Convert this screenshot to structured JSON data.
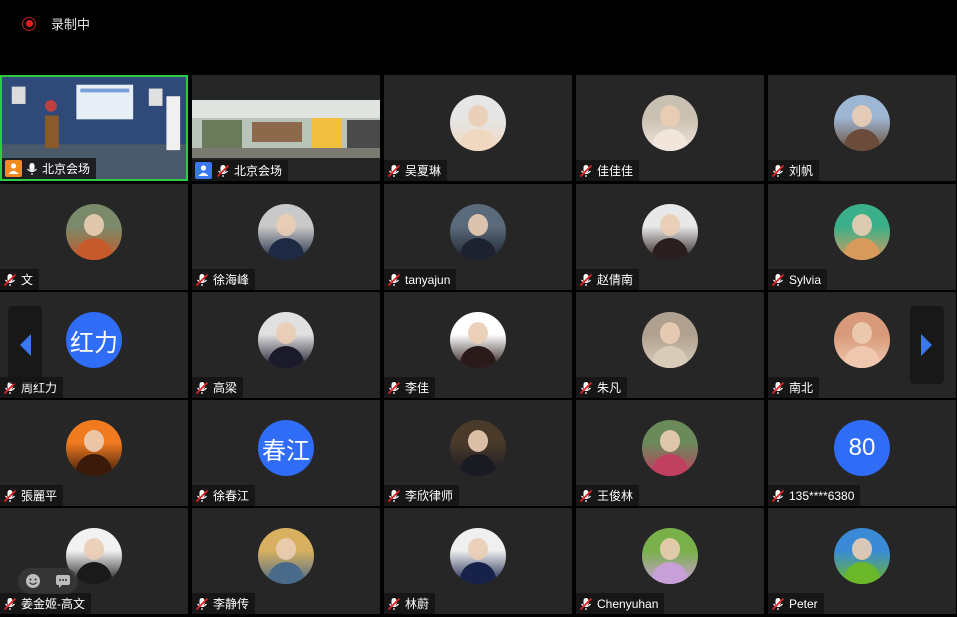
{
  "recording": {
    "label": "录制中",
    "color": "#e02020"
  },
  "tiles": [
    {
      "name": "北京会场",
      "kind": "video",
      "active": true,
      "host": "orange"
    },
    {
      "name": "北京会场",
      "kind": "video",
      "active": false,
      "host": "blue"
    },
    {
      "name": "吴夏琳",
      "kind": "photo",
      "bg": [
        "#e6e6e6",
        "#f0d8c0"
      ]
    },
    {
      "name": "佳佳佳",
      "kind": "photo",
      "bg": [
        "#c8c0b0",
        "#f2e6dc"
      ]
    },
    {
      "name": "刘帆",
      "kind": "photo",
      "bg": [
        "#9db6d4",
        "#6b4c3b"
      ]
    },
    {
      "name": "文",
      "kind": "photo",
      "bg": [
        "#7a8a6a",
        "#c65a2a"
      ]
    },
    {
      "name": "徐海峰",
      "kind": "photo",
      "bg": [
        "#c9c9c9",
        "#1e2a44"
      ]
    },
    {
      "name": "tanyajun",
      "kind": "photo",
      "bg": [
        "#5a6a7a",
        "#1e2230"
      ]
    },
    {
      "name": "赵倩南",
      "kind": "photo",
      "bg": [
        "#e8e8e8",
        "#2a1e1e"
      ]
    },
    {
      "name": "Sylvia",
      "kind": "photo",
      "bg": [
        "#3ab08a",
        "#d89a5a"
      ]
    },
    {
      "name": "周红力",
      "kind": "text",
      "initials": "红力"
    },
    {
      "name": "高梁",
      "kind": "photo",
      "bg": [
        "#e0e0e0",
        "#1a1a2a"
      ]
    },
    {
      "name": "李佳",
      "kind": "photo",
      "bg": [
        "#ffffff",
        "#2a1a1a"
      ]
    },
    {
      "name": "朱凡",
      "kind": "photo",
      "bg": [
        "#b0a090",
        "#d8cbb8"
      ]
    },
    {
      "name": "南北",
      "kind": "photo",
      "bg": [
        "#d89a7a",
        "#f0c8b0"
      ]
    },
    {
      "name": "張麗平",
      "kind": "photo",
      "bg": [
        "#f07a20",
        "#3a1a0a"
      ]
    },
    {
      "name": "徐春江",
      "kind": "text",
      "initials": "春江"
    },
    {
      "name": "李欣律师",
      "kind": "photo",
      "bg": [
        "#4a3a2a",
        "#1a1a22"
      ]
    },
    {
      "name": "王俊林",
      "kind": "photo",
      "bg": [
        "#6a8a5a",
        "#c04060"
      ]
    },
    {
      "name": "135****6380",
      "kind": "text",
      "initials": "80"
    },
    {
      "name": "姜金姬-高文",
      "kind": "photo",
      "bg": [
        "#f2f2f2",
        "#1a1a1a"
      ]
    },
    {
      "name": "李静传",
      "kind": "photo",
      "bg": [
        "#d8b060",
        "#4a6a8a"
      ]
    },
    {
      "name": "林蔚",
      "kind": "photo",
      "bg": [
        "#f0f0f0",
        "#16224a"
      ]
    },
    {
      "name": "Chenyuhan",
      "kind": "photo",
      "bg": [
        "#7ab04a",
        "#c8a0d8"
      ]
    },
    {
      "name": "Peter",
      "kind": "photo",
      "bg": [
        "#3a8ad8",
        "#6ab82a"
      ]
    }
  ],
  "icons": {
    "muted_mic": "muted-mic-icon",
    "mic": "mic-icon",
    "host": "person-icon",
    "arrow_left": "chevron-left-icon",
    "arrow_right": "chevron-right-icon",
    "emoji": "emoji-icon",
    "chat": "chat-icon"
  },
  "colors": {
    "accent": "#3a78f2",
    "active_border": "#2ecc40",
    "muted": "#e02020"
  }
}
